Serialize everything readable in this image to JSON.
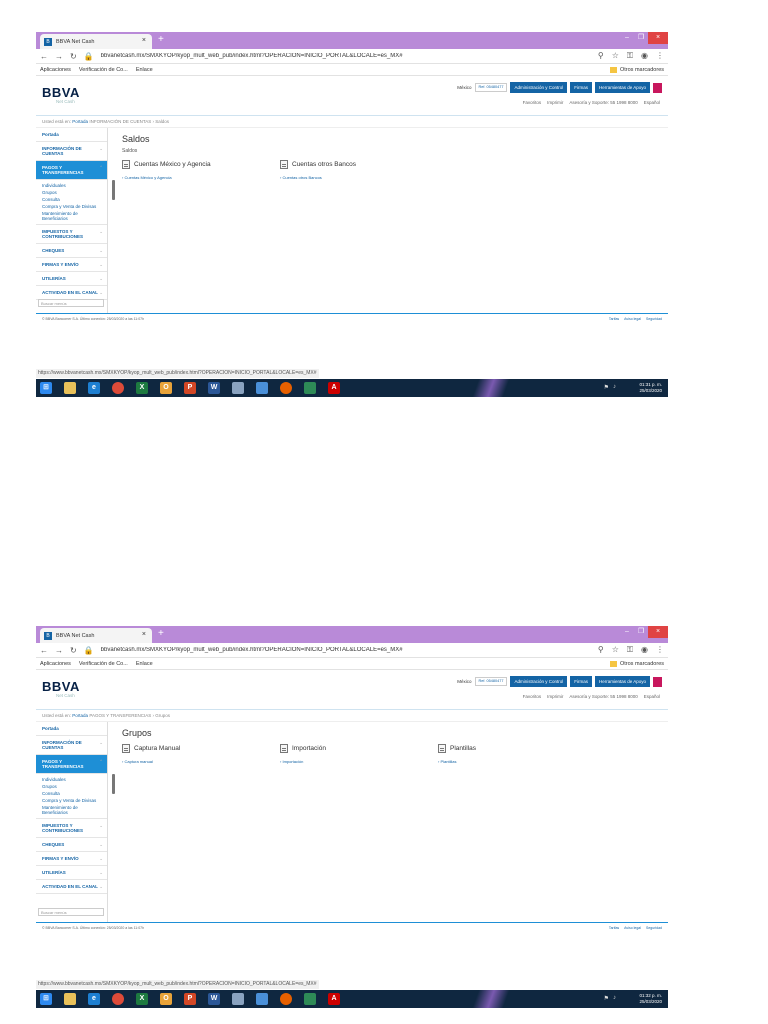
{
  "shot1": {
    "tab_title": "BBVA Net Cash",
    "url": "bbvanetcash.mx/SMXKYOP/kyop_mult_web_pub/index.html?OPERACION=INICIO_PORTAL&LOCALE=es_MX#",
    "bookmarks": [
      "Aplicaciones",
      "Verificación de Co...",
      "Enlace"
    ],
    "other_bookmarks": "Otros marcadores",
    "logo": "BBVA",
    "logo_sub": "Net Cash",
    "country": "México",
    "client_ref": "Ref. 05480477",
    "header_buttons": [
      "Administración y Control",
      "Firmas",
      "Herramientas de Apoyo"
    ],
    "header_links": [
      "Favoritos",
      "Imprimir",
      "Asesoría y Soporte: 55 1998 8000",
      "Español"
    ],
    "breadcrumb_prefix": "Usted está en:",
    "breadcrumb_home": "Portada",
    "breadcrumb_rest": "INFORMACIÓN DE CUENTAS › Saldos",
    "sidebar": {
      "portada": "Portada",
      "info_cuentas": "INFORMACIÓN DE CUENTAS",
      "pagos": "PAGOS Y TRANSFERENCIAS",
      "pagos_sub": [
        "Individuales",
        "Grupos",
        "Consulta",
        "Compra y Venta de Divisas",
        "Mantenimiento de Beneficiarios"
      ],
      "impuestos": "IMPUESTOS Y CONTRIBUCIONES",
      "cheques": "CHEQUES",
      "firmas": "FIRMAS Y ENVÍO",
      "utilerias": "UTILERÍAS",
      "actividad": "ACTIVIDAD EN EL CANAL",
      "search_placeholder": "Buscar menús"
    },
    "page_title": "Saldos",
    "page_subtitle": "Saldos",
    "tiles": [
      {
        "title": "Cuentas México y Agencia",
        "link": "Cuentas México y Agencia"
      },
      {
        "title": "Cuentas otros Bancos",
        "link": "Cuentas otros Bancos"
      }
    ],
    "footer_text": "© BBVA Bancomer S.A. Último conexión: 25/03/2020 a las 11:07h",
    "footer_links": [
      "Tarifas",
      "Aviso legal",
      "Seguridad"
    ],
    "status_url": "https://www.bbvanetcash.mx/SMXKYOP/kyop_mult_web_pub/index.html?OPERACION=INICIO_PORTAL&LOCALE=es_MX#",
    "clock_time": "01:31 p. m.",
    "clock_date": "25/03/2020"
  },
  "shot2": {
    "tab_title": "BBVA Net Cash",
    "url": "bbvanetcash.mx/SMXKYOP/kyop_mult_web_pub/index.html?OPERACION=INICIO_PORTAL&LOCALE=es_MX#",
    "bookmarks": [
      "Aplicaciones",
      "Verificación de Co...",
      "Enlace"
    ],
    "other_bookmarks": "Otros marcadores",
    "logo": "BBVA",
    "logo_sub": "Net Cash",
    "country": "México",
    "client_ref": "Ref. 05480477",
    "header_buttons": [
      "Administración y Control",
      "Firmas",
      "Herramientas de Apoyo"
    ],
    "header_links": [
      "Favoritos",
      "Imprimir",
      "Asesoría y Soporte: 55 1998 8000",
      "Español"
    ],
    "breadcrumb_prefix": "Usted está en:",
    "breadcrumb_home": "Portada",
    "breadcrumb_rest": "PAGOS Y TRANSFERENCIAS › Grupos",
    "sidebar": {
      "portada": "Portada",
      "info_cuentas": "INFORMACIÓN DE CUENTAS",
      "pagos": "PAGOS Y TRANSFERENCIAS",
      "pagos_sub": [
        "Individuales",
        "Grupos",
        "Consulta",
        "Compra y Venta de Divisas",
        "Mantenimiento de Beneficiarios"
      ],
      "impuestos": "IMPUESTOS Y CONTRIBUCIONES",
      "cheques": "CHEQUES",
      "firmas": "FIRMAS Y ENVÍO",
      "utilerias": "UTILERÍAS",
      "actividad": "ACTIVIDAD EN EL CANAL",
      "search_placeholder": "Buscar menús"
    },
    "page_title": "Grupos",
    "tiles": [
      {
        "title": "Captura Manual",
        "link": "Captura manual"
      },
      {
        "title": "Importación",
        "link": "Importación"
      },
      {
        "title": "Plantillas",
        "link": "Plantillas"
      }
    ],
    "footer_text": "© BBVA Bancomer S.A. Último conexión: 25/03/2020 a las 11:07h",
    "footer_links": [
      "Tarifas",
      "Aviso legal",
      "Seguridad"
    ],
    "status_url": "https://www.bbvanetcash.mx/SMXKYOP/kyop_mult_web_pub/index.html?OPERACION=INICIO_PORTAL&LOCALE=es_MX#",
    "clock_time": "01:32 p. m.",
    "clock_date": "25/03/2020"
  },
  "colors": {
    "chrome_tabbar": "#b98ad8",
    "bbva_blue": "#1464a5",
    "menu_active": "#1e8fd6",
    "taskbar": "#0f2740"
  },
  "icons": {
    "taskbar": [
      "windows-icon",
      "explorer-icon",
      "ie-icon",
      "chrome-icon",
      "excel-icon",
      "outlook-icon",
      "powerpoint-icon",
      "word-icon",
      "notepad-icon",
      "app-icon",
      "firefox-icon",
      "green-app-icon",
      "acrobat-icon"
    ]
  }
}
